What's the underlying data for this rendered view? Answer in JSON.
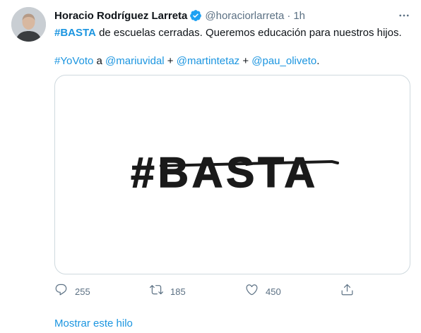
{
  "tweet": {
    "display_name": "Horacio Rodríguez Larreta",
    "handle": "@horaciorlarreta",
    "separator": "·",
    "time": "1h",
    "line1": {
      "hashtag": "#BASTA",
      "rest": " de escuelas cerradas. Queremos educación para nuestros hijos."
    },
    "line2": {
      "hashtag": "#YoVoto",
      "a": " a ",
      "mention1": "@mariuvidal",
      "plus1": " + ",
      "mention2": "@martintetaz",
      "plus2": " + ",
      "mention3": "@pau_oliveto",
      "end": "."
    },
    "media_text": "#BASTA",
    "actions": {
      "reply_count": "255",
      "retweet_count": "185",
      "like_count": "450"
    },
    "show_thread": "Mostrar este hilo"
  },
  "icons": {
    "verified": "verified-badge-icon",
    "more": "more-icon",
    "reply": "reply-icon",
    "retweet": "retweet-icon",
    "like": "heart-icon",
    "share": "share-icon"
  },
  "colors": {
    "accent": "#1b95e0",
    "verified": "#1da1f2",
    "muted": "#5b7083",
    "text": "#0f1419"
  }
}
